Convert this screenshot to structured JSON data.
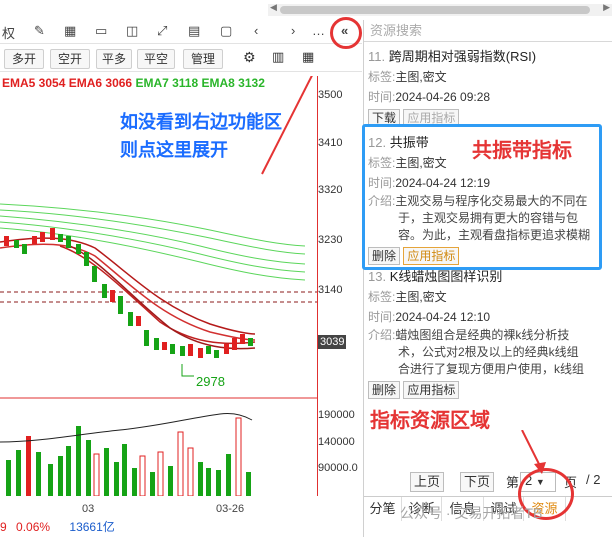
{
  "toolbar_top": {
    "first_char": "权",
    "close_glyph": "✕",
    "more": "…"
  },
  "buttons": [
    "多开",
    "空开",
    "平多",
    "平空",
    "管理"
  ],
  "ema": {
    "ema5": "EMA5 3054",
    "ema6": "EMA6 3066",
    "ema7": "EMA7 3118",
    "ema8": "EMA8 3132"
  },
  "price_axis": [
    "3500",
    "3410",
    "3320",
    "3230",
    "3140",
    "3039"
  ],
  "volume_axis": [
    "190000",
    "140000",
    "90000.0"
  ],
  "current_price": "3039",
  "low_label": "2978",
  "dates": {
    "d1": "03",
    "d2": "03-26"
  },
  "annotations": {
    "expand_line1": "如没看到右边功能区",
    "expand_line2": "则点这里展开",
    "resonance": "共振带指标",
    "resource_area": "指标资源区域"
  },
  "bottom_status": {
    "a": "9",
    "b": "0.06%",
    "c": "13661亿"
  },
  "right_panel": {
    "search_placeholder": "资源搜索",
    "items": [
      {
        "num": "11.",
        "title": "跨周期相对强弱指数(RSI)",
        "tag_label": "标签:",
        "tags": "主图,密文",
        "time_label": "时间:",
        "time": "2024-04-26 09:28",
        "btn1": "下载",
        "btn2": "应用指标"
      },
      {
        "num": "12.",
        "title": "共振带",
        "tag_label": "标签:",
        "tags": "主图,密文",
        "time_label": "时间:",
        "time": "2024-04-24 12:19",
        "desc_label": "介绍:",
        "desc1": "主观交易与程序化交易最大的不同在",
        "desc2": "于，主观交易拥有更大的容错与包",
        "desc3": "容。为此，主观看盘指标更追求模糊",
        "btn1": "删除",
        "btn2": "应用指标"
      },
      {
        "num": "13.",
        "title": "K线蜡烛图图样识别",
        "tag_label": "标签:",
        "tags": "主图,密文",
        "time_label": "时间:",
        "time": "2024-04-24 12:10",
        "desc_label": "介绍:",
        "desc1": "蜡烛图组合是经典的裸k线分析技",
        "desc2": "术，公式对2根及以上的经典k线组",
        "desc3": "合进行了复现方便用户使用，k线组",
        "btn1": "删除",
        "btn2": "应用指标"
      }
    ],
    "pager": {
      "prev": "上页",
      "next": "下页",
      "page_prefix": "第",
      "page_value": "2",
      "page_suffix": "页",
      "total": "/ 2"
    },
    "tabs": [
      "分笔",
      "诊断",
      "信息",
      "调试",
      "资源"
    ]
  },
  "watermark": "公众号 · 交易开拓者TB",
  "colors": {
    "accent_blue": "#1a6cff",
    "accent_red": "#e53434",
    "candle_red": "#e02020",
    "candle_green": "#16a316"
  }
}
